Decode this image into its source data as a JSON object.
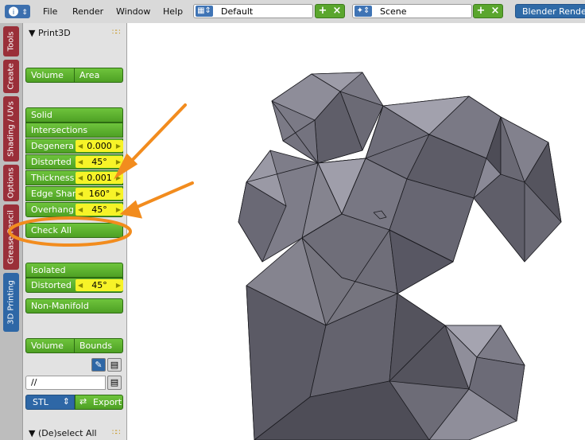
{
  "menu": {
    "items": [
      "File",
      "Render",
      "Window",
      "Help"
    ]
  },
  "header": {
    "info_icon": "info-icon",
    "screen_layout": "Default",
    "scene": "Scene",
    "render_engine": "Blender Render",
    "add_label": "+",
    "remove_label": "×"
  },
  "tabs": [
    "Tools",
    "Create",
    "Shading / UVs",
    "Options",
    "Grease Pencil",
    "3D Printing"
  ],
  "active_tab": "3D Printing",
  "panel": {
    "title": "Print3D",
    "stats": {
      "volume": "Volume",
      "area": "Area"
    },
    "checks": {
      "solid": "Solid",
      "intersections": "Intersections",
      "rows": [
        {
          "label": "Degenera",
          "value": "0.000"
        },
        {
          "label": "Distorted",
          "value": "45°"
        },
        {
          "label": "Thickness",
          "value": "0.001"
        },
        {
          "label": "Edge Shar",
          "value": "160°"
        },
        {
          "label": "Overhang",
          "value": "45°"
        }
      ],
      "check_all": "Check All"
    },
    "cleanup": {
      "isolated": "Isolated",
      "distorted_label": "Distorted",
      "distorted_value": "45°",
      "non_manifold": "Non-Manifold"
    },
    "scale": {
      "volume": "Volume",
      "bounds": "Bounds"
    },
    "export": {
      "path": "//",
      "format": "STL",
      "export_label": "Export"
    },
    "next_panel": "(De)select All"
  },
  "colors": {
    "button_green": "#5cb02e",
    "value_yellow": "#f7f328",
    "tab_red": "#9a2f39",
    "tab_blue": "#2e67a6",
    "annotation_orange": "#f28c1e",
    "mesh_gray": "#6a6a72"
  }
}
